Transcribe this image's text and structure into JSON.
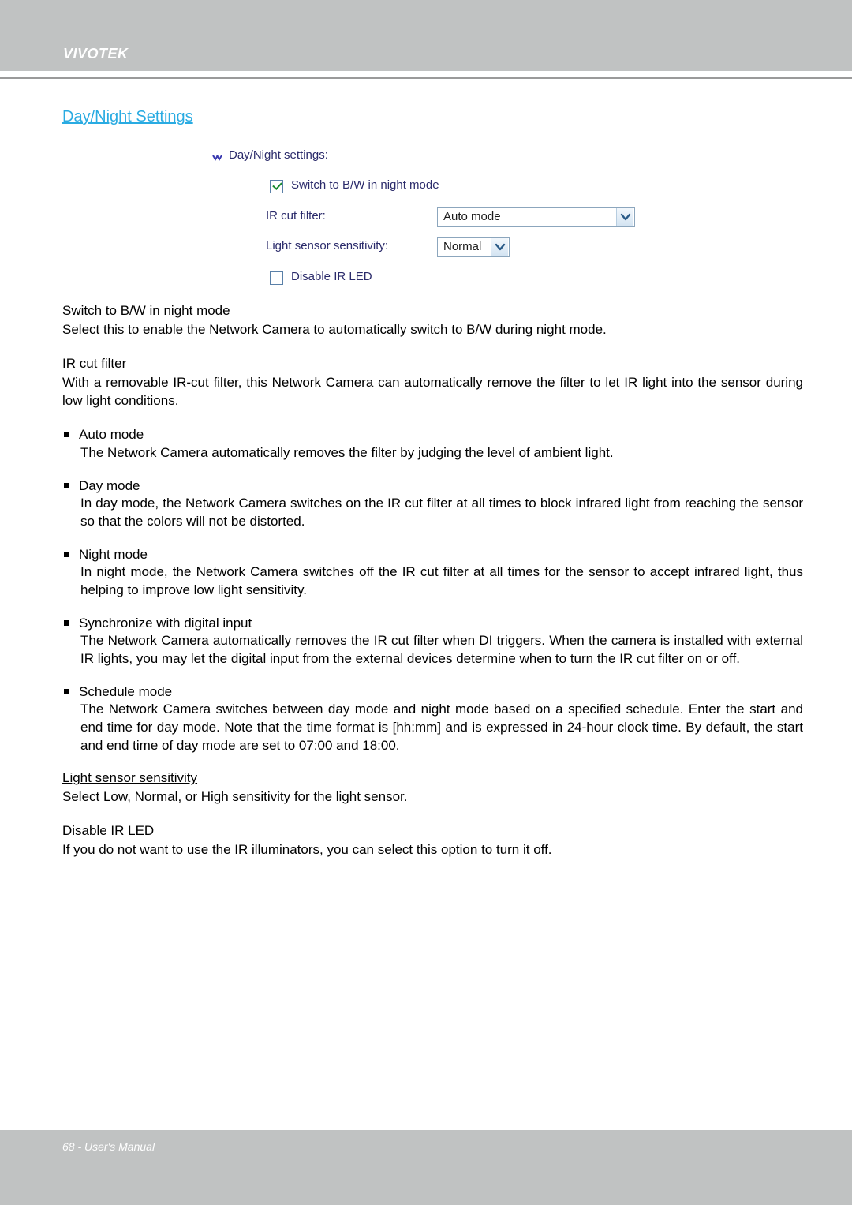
{
  "header": {
    "brand": "VIVOTEK"
  },
  "section": {
    "title": "Day/Night Settings"
  },
  "settings_panel": {
    "panel_title": "Day/Night settings:",
    "expand_icon": "chevron-double-down-icon",
    "switch_bw": {
      "label": "Switch to B/W in night mode",
      "checked": true
    },
    "ir_cut_filter": {
      "label": "IR cut filter:",
      "value": "Auto mode",
      "options": [
        "Auto mode",
        "Day mode",
        "Night mode",
        "Synchronize with digital input",
        "Schedule mode"
      ]
    },
    "light_sensor": {
      "label": "Light sensor sensitivity:",
      "value": "Normal",
      "options": [
        "Low",
        "Normal",
        "High"
      ]
    },
    "disable_ir_led": {
      "label": "Disable IR LED",
      "checked": false
    }
  },
  "body": {
    "switch_bw": {
      "term": "Switch to B/W in night mode",
      "text": "Select this to enable the Network Camera to automatically switch to B/W during night mode."
    },
    "ir_cut_filter": {
      "term": "IR cut filter",
      "text": "With a removable IR-cut filter, this Network Camera can automatically remove the filter to let IR light into the sensor during low light conditions."
    },
    "modes": [
      {
        "title": "Auto mode",
        "text": "The Network Camera automatically removes the filter by judging the level of ambient light."
      },
      {
        "title": "Day mode",
        "text": "In day mode, the Network Camera switches on the IR cut filter at all times to block infrared light from reaching the sensor so that the colors will not be distorted."
      },
      {
        "title": "Night mode",
        "text": "In night mode, the Network Camera switches off the IR cut filter at all times for the sensor to accept infrared light, thus helping to improve low light sensitivity."
      },
      {
        "title": "Synchronize with digital input",
        "text": "The Network Camera automatically removes the IR cut filter when DI triggers. When the camera is installed with external IR lights, you may let the digital input from the external devices determine when to turn the IR cut filter on or off."
      },
      {
        "title": "Schedule mode",
        "text": "The Network Camera switches between day mode and night mode based on a specified schedule. Enter the start and end time for day mode. Note that the time format is [hh:mm] and is expressed in 24-hour clock time. By default, the start and end time of day mode are set to 07:00 and 18:00."
      }
    ],
    "light_sensor": {
      "term": "Light sensor sensitivity",
      "text": "Select Low, Normal, or High sensitivity for the light sensor."
    },
    "disable_ir_led": {
      "term": "Disable IR LED",
      "text": "If you do not want to use the IR illuminators, you can select this option to turn it off."
    }
  },
  "footer": {
    "text": "68 - User's Manual"
  },
  "colors": {
    "band": "#c0c2c2",
    "link": "#29abe2",
    "ui_label": "#2b2b6b",
    "check": "#188a2e"
  }
}
